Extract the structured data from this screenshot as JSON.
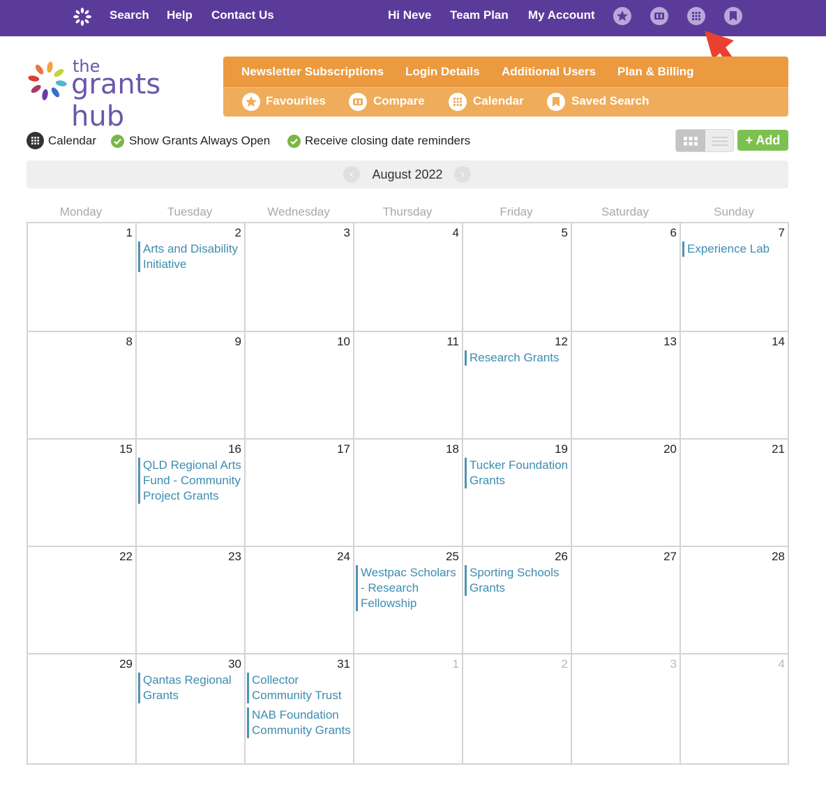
{
  "topnav": {
    "left_links": [
      "Search",
      "Help",
      "Contact Us"
    ],
    "right_links": [
      "Hi Neve",
      "Team Plan",
      "My Account"
    ],
    "icons": [
      "star-icon",
      "compare-icon",
      "calendar-icon",
      "bookmark-icon"
    ]
  },
  "brand": {
    "the": "the",
    "name": "grants hub"
  },
  "orange_nav": {
    "row1": [
      "Newsletter Subscriptions",
      "Login Details",
      "Additional Users",
      "Plan & Billing"
    ],
    "row2": [
      "Favourites",
      "Compare",
      "Calendar",
      "Saved Search"
    ]
  },
  "options": {
    "calendar_label": "Calendar",
    "show_open": "Show Grants Always Open",
    "reminders": "Receive closing date reminders",
    "add_button": "+ Add"
  },
  "month": {
    "label": "August 2022",
    "prev": "‹",
    "next": "›"
  },
  "weekdays": [
    "Monday",
    "Tuesday",
    "Wednesday",
    "Thursday",
    "Friday",
    "Saturday",
    "Sunday"
  ],
  "weeks": [
    [
      {
        "d": "1"
      },
      {
        "d": "2",
        "events": [
          "Arts and Disability Initiative"
        ]
      },
      {
        "d": "3"
      },
      {
        "d": "4"
      },
      {
        "d": "5"
      },
      {
        "d": "6"
      },
      {
        "d": "7",
        "events": [
          "Experience Lab"
        ]
      }
    ],
    [
      {
        "d": "8"
      },
      {
        "d": "9"
      },
      {
        "d": "10"
      },
      {
        "d": "11"
      },
      {
        "d": "12",
        "events": [
          "Research Grants"
        ]
      },
      {
        "d": "13"
      },
      {
        "d": "14"
      }
    ],
    [
      {
        "d": "15"
      },
      {
        "d": "16",
        "events": [
          "QLD Regional Arts Fund - Community Project Grants"
        ]
      },
      {
        "d": "17"
      },
      {
        "d": "18"
      },
      {
        "d": "19",
        "events": [
          "Tucker Foundation Grants"
        ]
      },
      {
        "d": "20"
      },
      {
        "d": "21"
      }
    ],
    [
      {
        "d": "22"
      },
      {
        "d": "23"
      },
      {
        "d": "24"
      },
      {
        "d": "25",
        "events": [
          "Westpac Scholars - Research Fellowship"
        ]
      },
      {
        "d": "26",
        "events": [
          "Sporting Schools Grants"
        ]
      },
      {
        "d": "27"
      },
      {
        "d": "28"
      }
    ],
    [
      {
        "d": "29"
      },
      {
        "d": "30",
        "events": [
          "Qantas Regional Grants"
        ]
      },
      {
        "d": "31",
        "events": [
          "Collector Community Trust",
          "NAB Foundation Community Grants"
        ]
      },
      {
        "d": "1",
        "other": true
      },
      {
        "d": "2",
        "other": true
      },
      {
        "d": "3",
        "other": true
      },
      {
        "d": "4",
        "other": true
      }
    ]
  ],
  "colors": {
    "topbar": "#5b3b9a",
    "orange": "#eb9a3f",
    "event": "#3d8cb0",
    "add": "#7cc150"
  }
}
